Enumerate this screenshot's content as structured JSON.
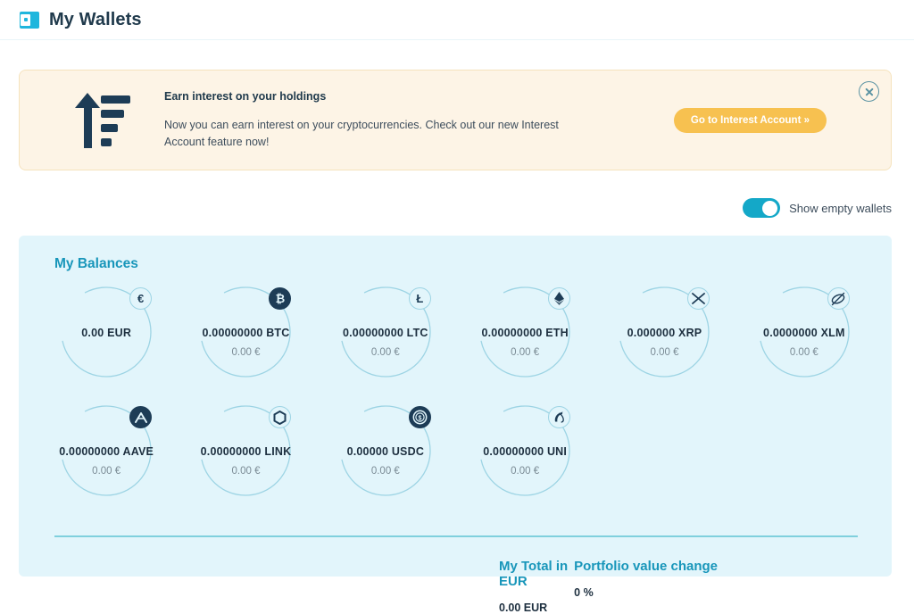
{
  "header": {
    "title": "My Wallets",
    "icon": "wallet-icon"
  },
  "banner": {
    "icon": "growth-arrow-icon",
    "title": "Earn interest on your holdings",
    "body": "Now you can earn interest on your cryptocurrencies. Check out our new Interest Account feature now!",
    "cta_label": "Go to Interest Account »",
    "close_icon": "close-circle-icon",
    "bg_color": "#fdf4e6",
    "border_color": "#f5e3bd",
    "cta_color": "#f7c150"
  },
  "toggle": {
    "label": "Show empty wallets",
    "state": "on",
    "color": "#14a8c8"
  },
  "balances": {
    "title": "My Balances",
    "panel_color": "#e2f5fb",
    "accent_color": "#1896ba",
    "ring_color": "#9dd4e4",
    "row1": [
      {
        "symbol": "EUR",
        "amount": "0.00 EUR",
        "fiat": "",
        "icon": "euro-icon",
        "glyph": "€",
        "filled": false
      },
      {
        "symbol": "BTC",
        "amount": "0.00000000 BTC",
        "fiat": "0.00 €",
        "icon": "bitcoin-icon",
        "glyph": "₿",
        "filled": true
      },
      {
        "symbol": "LTC",
        "amount": "0.00000000 LTC",
        "fiat": "0.00 €",
        "icon": "litecoin-icon",
        "glyph": "Ł",
        "filled": false
      },
      {
        "symbol": "ETH",
        "amount": "0.00000000 ETH",
        "fiat": "0.00 €",
        "icon": "ethereum-icon",
        "glyph": "♦",
        "filled": false
      },
      {
        "symbol": "XRP",
        "amount": "0.000000 XRP",
        "fiat": "0.00 €",
        "icon": "ripple-icon",
        "glyph": "✕",
        "filled": false
      },
      {
        "symbol": "XLM",
        "amount": "0.0000000 XLM",
        "fiat": "0.00 €",
        "icon": "stellar-icon",
        "glyph": "⊘",
        "filled": false
      }
    ],
    "row2": [
      {
        "symbol": "AAVE",
        "amount": "0.00000000 AAVE",
        "fiat": "0.00 €",
        "icon": "aave-icon",
        "glyph": "Λ",
        "filled": true
      },
      {
        "symbol": "LINK",
        "amount": "0.00000000 LINK",
        "fiat": "0.00 €",
        "icon": "chainlink-icon",
        "glyph": "⬡",
        "filled": false
      },
      {
        "symbol": "USDC",
        "amount": "0.00000 USDC",
        "fiat": "0.00 €",
        "icon": "usdc-icon",
        "glyph": "$",
        "filled": true
      },
      {
        "symbol": "UNI",
        "amount": "0.00000000 UNI",
        "fiat": "0.00 €",
        "icon": "uniswap-icon",
        "glyph": "♞",
        "filled": false
      }
    ]
  },
  "totals": {
    "total_label": "My Total in EUR",
    "total_value": "0.00 EUR",
    "change_label": "Portfolio value change",
    "change_value": "0 %"
  }
}
